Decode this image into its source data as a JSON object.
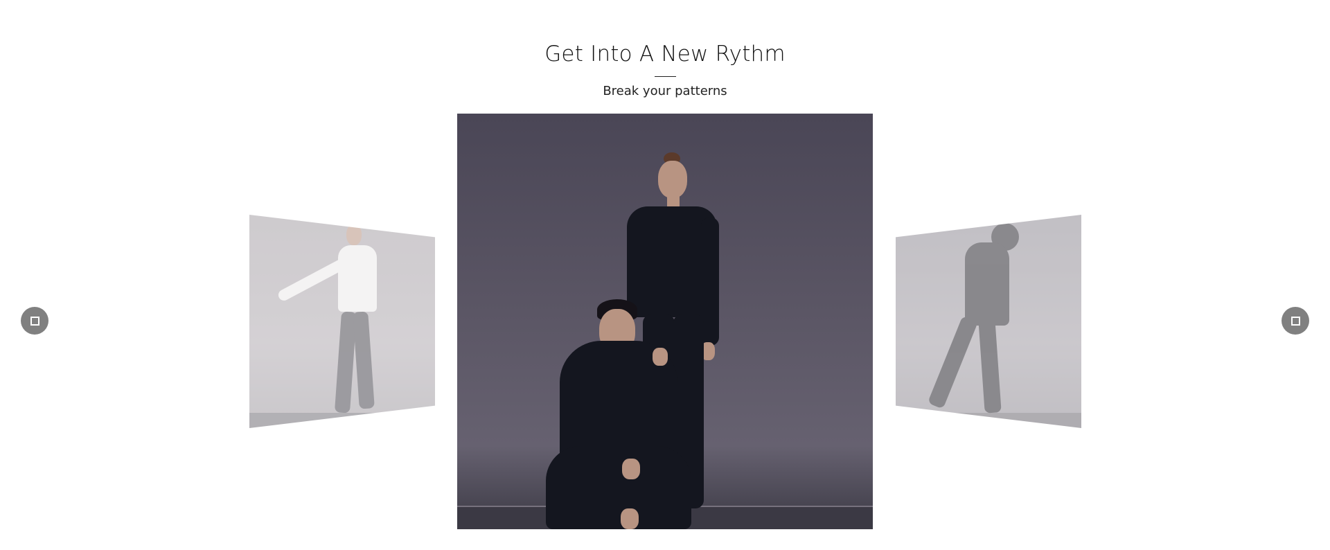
{
  "section": {
    "title": "Get Into A New Rythm",
    "subtitle": "Break your patterns"
  },
  "carousel": {
    "slides": [
      {
        "position": "previous",
        "image": "woman-light-sweatshirt-stretching"
      },
      {
        "position": "current",
        "image": "couple-dark-sweatsuits-studio"
      },
      {
        "position": "next",
        "image": "man-hoodie-walking"
      }
    ],
    "prev_icon": "square-prev-icon",
    "next_icon": "square-next-icon"
  },
  "colors": {
    "background": "#ffffff",
    "nav_button": "#808080",
    "text": "#111111"
  }
}
